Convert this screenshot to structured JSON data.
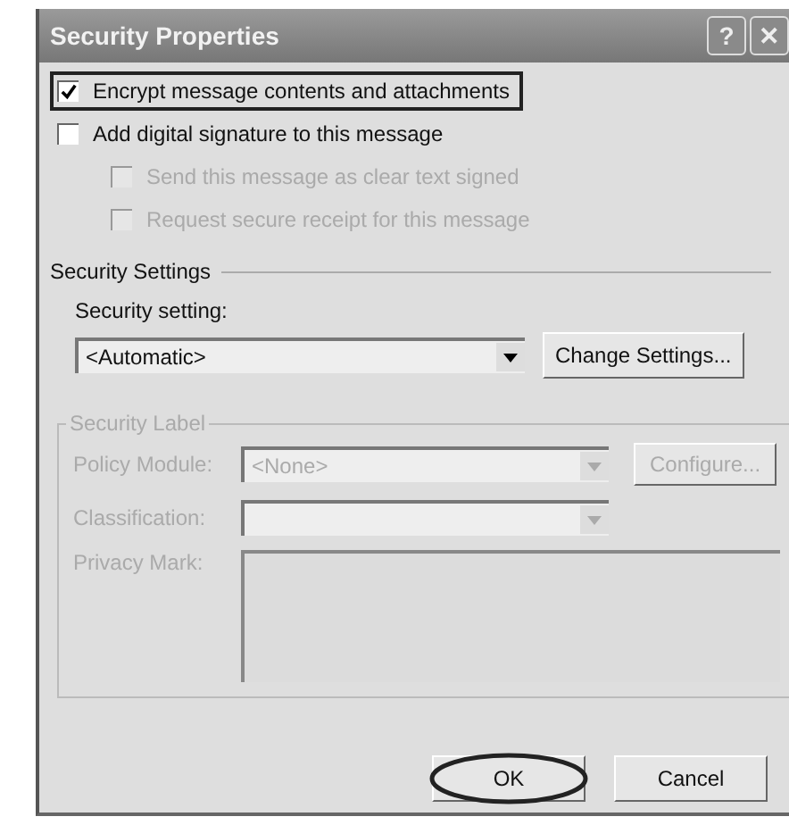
{
  "window": {
    "title": "Security Properties",
    "title_buttons": [
      "?",
      "✕"
    ]
  },
  "options": [
    {
      "label": "Encrypt message contents and attachments",
      "checked": true,
      "disabled": false,
      "highlighted": true
    },
    {
      "label": "Add digital signature to this message",
      "checked": false,
      "disabled": false,
      "highlighted": false,
      "children": [
        {
          "label": "Send this message as clear text signed",
          "checked": false,
          "disabled": true,
          "highlighted": false
        },
        {
          "label": "Request secure receipt for this message",
          "checked": false,
          "disabled": true,
          "highlighted": false
        }
      ]
    }
  ],
  "security_settings": {
    "title": "Security Settings",
    "setting_label": "Security setting:",
    "value": "<Automatic>",
    "button": "Change Settings..."
  },
  "security_label": {
    "title": "Security Label",
    "disabled": true,
    "policy_label": "Policy Module:",
    "policy_value": "<None>",
    "configure_button": "Configure...",
    "classification_label": "Classification:",
    "privacy_label": "Privacy Mark:"
  },
  "buttons": [
    {
      "label": "OK",
      "circled": true
    },
    {
      "label": "Cancel",
      "circled": false
    }
  ]
}
